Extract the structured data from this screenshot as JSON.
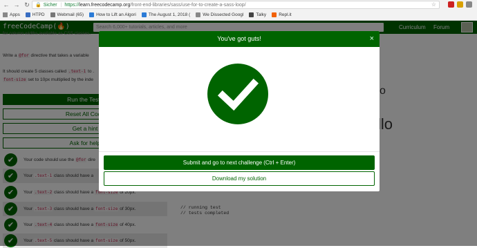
{
  "browser": {
    "secure_label": "Sicher",
    "url_proto": "https://",
    "url_host": "learn.freecodecamp.org",
    "url_path": "/front-end-libraries/sass/use-for-to-create-a-sass-loop/",
    "bookmarks": [
      {
        "label": "Apps",
        "color": "#4285f4"
      },
      {
        "label": "HTPD",
        "color": "#3a6ec2"
      },
      {
        "label": "Webmail (65)",
        "color": "#777777"
      },
      {
        "label": "How to Lift an Algori",
        "color": "#2b7bd6"
      },
      {
        "label": "The August 1, 2018 (",
        "color": "#2b7bd6"
      },
      {
        "label": "We Dissected Googl",
        "color": "#888888"
      },
      {
        "label": "Talky",
        "color": "#444444"
      },
      {
        "label": "Repl.it",
        "color": "#f26207"
      }
    ]
  },
  "fcc": {
    "logo": "freeCodeCamp(🔥)",
    "search_placeholder": "Search 6,000+ tutorials, articles, and more",
    "nav_curriculum": "Curriculum",
    "nav_forum": "Forum"
  },
  "left": {
    "fragment": "for column widths available as CSS classes.",
    "instr_a": "Write a ",
    "instr_code": "@for",
    "instr_b": " directive that takes a variable ",
    "instr2_a": "It should create 5 classes called ",
    "instr2_code": ".text-1",
    "instr2_b": " to .",
    "instr3_code": "font-size",
    "instr3_b": " set to 10px multiplied by the inde",
    "buttons": {
      "run": "Run the Tests",
      "reset": "Reset All Code",
      "hint": "Get a hint",
      "help": "Ask for help"
    },
    "tests": [
      {
        "pre": "Your code should use the ",
        "code": "@for",
        "post": " dire"
      },
      {
        "pre": "Your ",
        "code": ".text-1",
        "post": " class should have a "
      },
      {
        "pre": "Your ",
        "code": ".text-2",
        "post": " class should have a ",
        "code2": "font-size",
        "post2": " of 20px."
      },
      {
        "pre": "Your ",
        "code": ".text-3",
        "post": " class should have a ",
        "code2": "font-size",
        "post2": " of 30px."
      },
      {
        "pre": "Your ",
        "code": ".text-4",
        "post": " class should have a ",
        "code2": "font-size",
        "post2": " of 40px."
      },
      {
        "pre": "Your ",
        "code": ".text-5",
        "post": " class should have a ",
        "code2": "font-size",
        "post2": " of 50px."
      }
    ]
  },
  "preview": {
    "hello_small": "o",
    "hello_big": "llo"
  },
  "output": {
    "line1": "// running test",
    "line2": "// tests completed"
  },
  "modal": {
    "title": "You've got guts!",
    "close": "×",
    "submit_label": "Submit and go to next challenge (Ctrl + Enter)",
    "download_label": "Download my solution"
  },
  "colors": {
    "fcc_green": "#006400"
  }
}
